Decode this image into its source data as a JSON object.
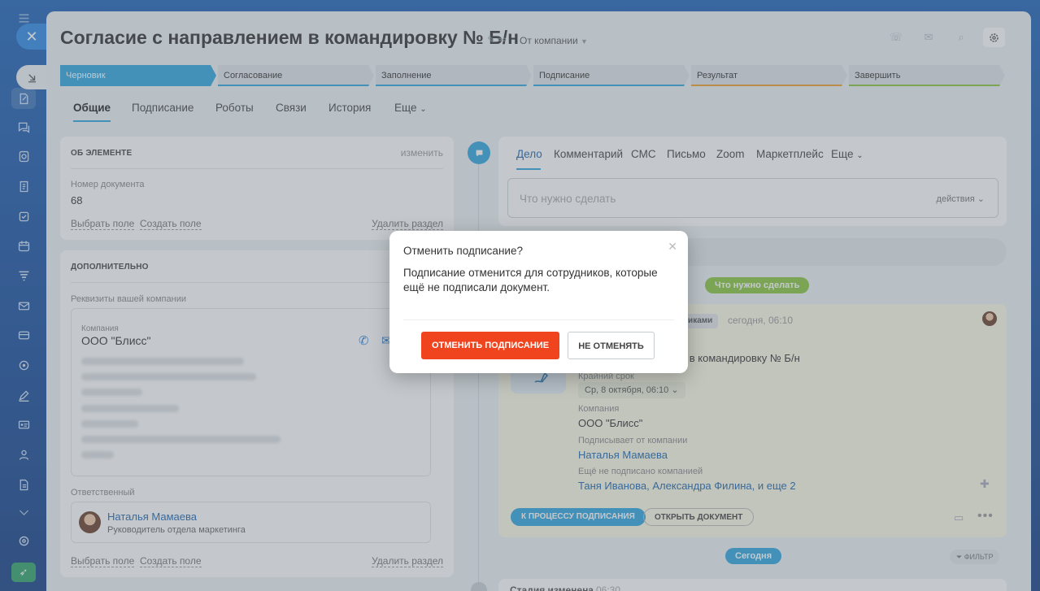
{
  "window": {
    "title": "Согласие с направлением в командировку № Б/н",
    "company_selector": "От компании"
  },
  "stages": [
    {
      "label": "Черновик",
      "color": "#2fa6e0",
      "active": true
    },
    {
      "label": "Согласование",
      "color": "#2fa6e0",
      "active": false
    },
    {
      "label": "Заполнение",
      "color": "#2fa6e0",
      "active": false
    },
    {
      "label": "Подписание",
      "color": "#2fa6e0",
      "active": false
    },
    {
      "label": "Результат",
      "color": "#f0a030",
      "active": false
    },
    {
      "label": "Завершить",
      "color": "#8cc63f",
      "active": false
    }
  ],
  "tabs": [
    "Общие",
    "Подписание",
    "Роботы",
    "Связи",
    "История",
    "Еще"
  ],
  "about": {
    "header": "ОБ ЭЛЕМЕНТЕ",
    "edit": "изменить",
    "doc_number_label": "Номер документа",
    "doc_number": "68",
    "select_field": "Выбрать поле",
    "create_field": "Создать поле",
    "delete_section": "Удалить раздел"
  },
  "extra": {
    "header": "ДОПОЛНИТЕЛЬНО",
    "requisites_label": "Реквизиты вашей компании",
    "company_label": "Компания",
    "company_name": "ООО \"Блисс\"",
    "responsible_label": "Ответственный",
    "responsible_name": "Наталья Мамаева",
    "responsible_role": "Руководитель отдела маркетинга",
    "select_field": "Выбрать поле",
    "create_field": "Создать поле",
    "delete_section": "Удалить раздел"
  },
  "activity": {
    "tabs": [
      "Дело",
      "Комментарий",
      "СМС",
      "Письмо",
      "Zoom",
      "Маркетплейс",
      "Еще"
    ],
    "placeholder": "Что нужно сделать",
    "actions": "действия"
  },
  "timeline": {
    "todo_pill": "Что нужно сделать",
    "participants_badge": "никами",
    "time": "сегодня, 06:10",
    "doc_title_fragment": "ем в командировку № Б/н",
    "deadline_label": "Крайний срок",
    "deadline_value": "Ср, 8 октября, 06:10",
    "company_label": "Компания",
    "company_value": "ООО \"Блисс\"",
    "signer_label": "Подписывает от компании",
    "signer_value": "Наталья Мамаева",
    "not_signed_label": "Ещё не подписано компанией",
    "not_signed_value": "Таня Иванова, Александра Филина, и еще 2",
    "process_button": "К ПРОЦЕССУ ПОДПИСАНИЯ",
    "open_doc_button": "ОТКРЫТЬ ДОКУМЕНТ",
    "today_pill": "Сегодня",
    "filter": "ФИЛЬТР",
    "stage_changed": "Стадия изменена",
    "stage_time": "06:30"
  },
  "dialog": {
    "title": "Отменить подписание?",
    "text": "Подписание отменится для сотрудников, которые ещё не подписали документ.",
    "confirm": "ОТМЕНИТЬ ПОДПИСАНИЕ",
    "cancel": "НЕ ОТМЕНЯТЬ",
    "confirm_color": "#f0441e"
  }
}
